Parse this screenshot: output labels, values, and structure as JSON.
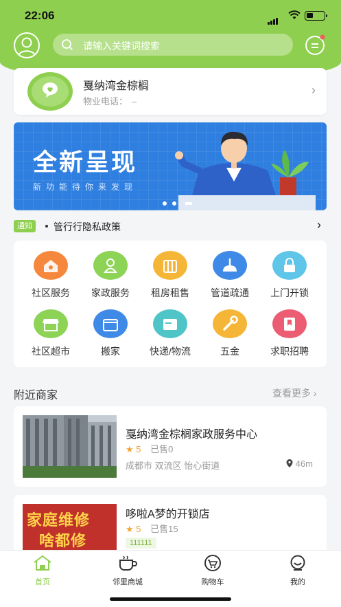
{
  "status_bar": {
    "time": "22:06"
  },
  "search": {
    "placeholder": "请输入关键词搜索"
  },
  "community": {
    "name": "戛纳湾金棕榈",
    "phone_label": "物业电话：",
    "phone_value": "–"
  },
  "banner": {
    "title": "全新呈现",
    "subtitle": "新功能待你来发现",
    "bg_color": "#2f7fe0"
  },
  "notice": {
    "tag": "通知",
    "text": "管行行隐私政策"
  },
  "services": [
    {
      "label": "社区服务",
      "icon": "house-icon",
      "color": "#f6883e"
    },
    {
      "label": "家政服务",
      "icon": "worker-icon",
      "color": "#8dd356"
    },
    {
      "label": "租房租售",
      "icon": "suitcase-icon",
      "color": "#f5b638"
    },
    {
      "label": "管道疏通",
      "icon": "plunger-icon",
      "color": "#3f8ae7"
    },
    {
      "label": "上门开锁",
      "icon": "lock-icon",
      "color": "#5fc6e9"
    },
    {
      "label": "社区超市",
      "icon": "store-icon",
      "color": "#8dd356"
    },
    {
      "label": "搬家",
      "icon": "truck-icon",
      "color": "#3f8ae7"
    },
    {
      "label": "快递/物流",
      "icon": "package-icon",
      "color": "#4fc5c8"
    },
    {
      "label": "五金",
      "icon": "wrench-icon",
      "color": "#f5b638"
    },
    {
      "label": "求职招聘",
      "icon": "bookmark-icon",
      "color": "#ec5c73"
    }
  ],
  "nearby": {
    "title": "附近商家",
    "more": "查看更多",
    "shops": [
      {
        "name": "戛纳湾金棕榈家政服务中心",
        "rating": "5",
        "sold": "已售0",
        "address": "成都市 双流区 怡心街道",
        "distance": "46m"
      },
      {
        "name": "哆啦A梦的开锁店",
        "rating": "5",
        "sold": "已售15",
        "tag": "111111",
        "image_text_1": "家庭维修",
        "image_text_2": "啥都修"
      }
    ]
  },
  "tabs": [
    {
      "label": "首页",
      "icon": "home-icon",
      "active": true
    },
    {
      "label": "邻里商城",
      "icon": "cup-icon"
    },
    {
      "label": "购物车",
      "icon": "cart-icon"
    },
    {
      "label": "我的",
      "icon": "profile-icon"
    }
  ],
  "colors": {
    "brand": "#8fcf4f",
    "star": "#f0a53a"
  }
}
